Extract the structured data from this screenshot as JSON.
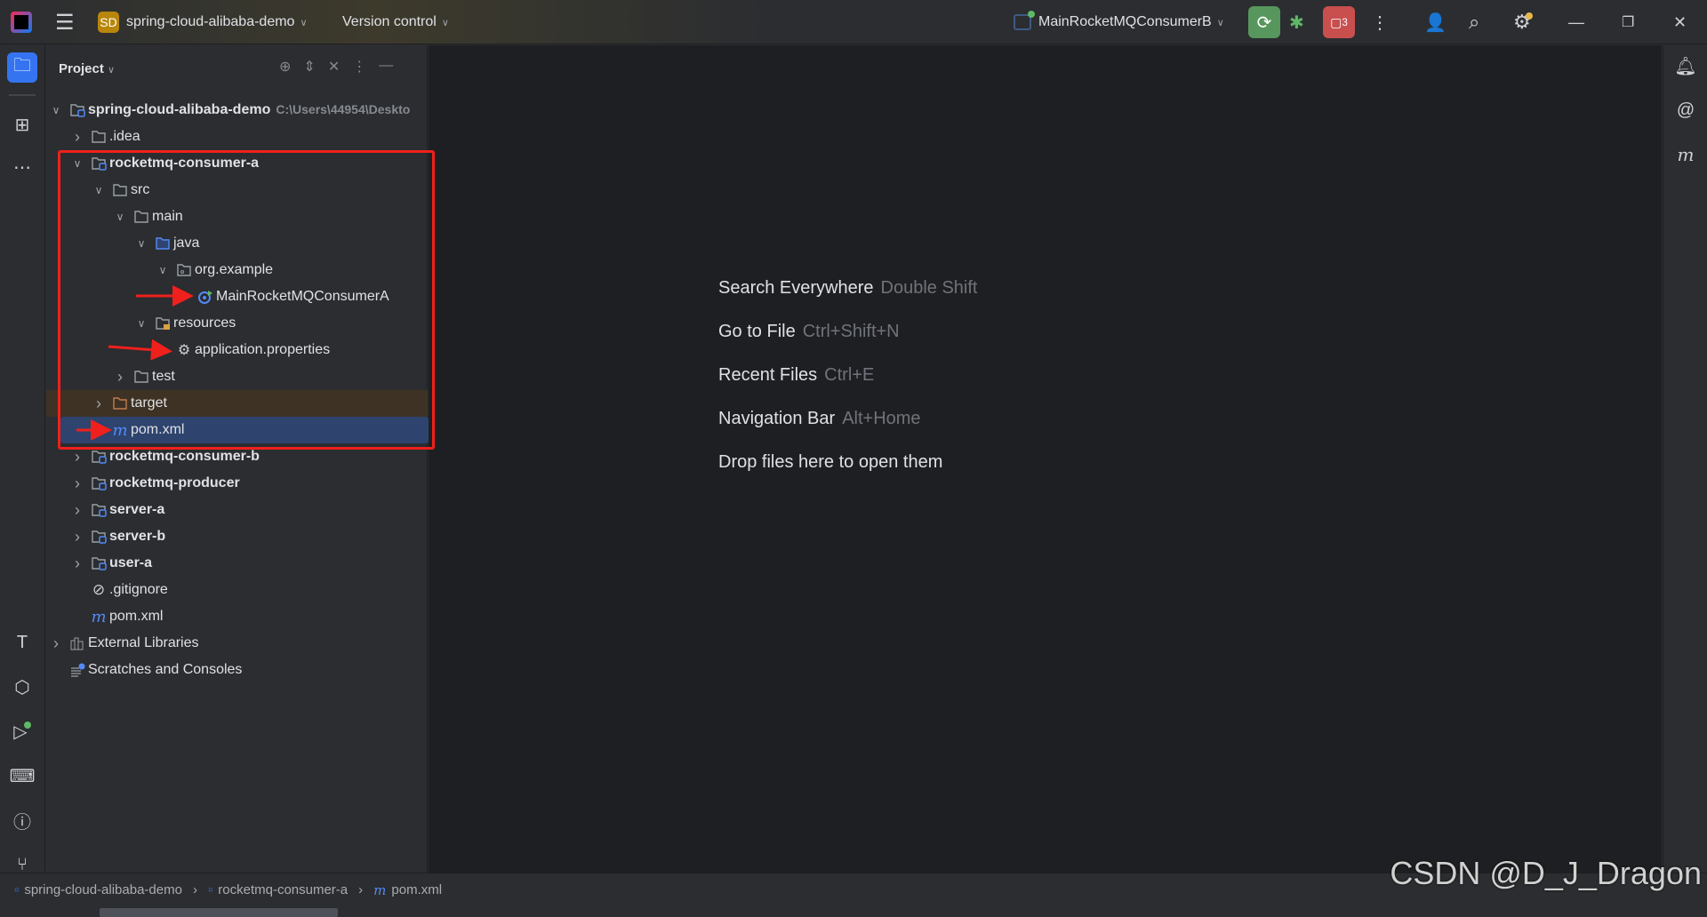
{
  "titlebar": {
    "project_badge": "SD",
    "project_name": "spring-cloud-alibaba-demo",
    "vcs_label": "Version control",
    "run_config": "MainRocketMQConsumerB",
    "stop_count": "3"
  },
  "left_strip": [
    "project-icon",
    "structure-icon",
    "more-icon",
    "build-icon",
    "services-icon",
    "run-icon",
    "terminal-icon",
    "problems-icon",
    "git-icon"
  ],
  "panel": {
    "title": "Project",
    "tree": [
      {
        "label": "spring-cloud-alibaba-demo",
        "level": 0,
        "chevron": "open",
        "icon": "module",
        "bold": true,
        "hint": "C:\\Users\\44954\\Deskto"
      },
      {
        "label": ".idea",
        "level": 1,
        "chevron": "closed",
        "icon": "folder"
      },
      {
        "label": "rocketmq-consumer-a",
        "level": 1,
        "chevron": "open",
        "icon": "module",
        "bold": true
      },
      {
        "label": "src",
        "level": 2,
        "chevron": "open",
        "icon": "folder"
      },
      {
        "label": "main",
        "level": 3,
        "chevron": "open",
        "icon": "folder"
      },
      {
        "label": "java",
        "level": 4,
        "chevron": "open",
        "icon": "source-folder"
      },
      {
        "label": "org.example",
        "level": 5,
        "chevron": "open",
        "icon": "package"
      },
      {
        "label": "MainRocketMQConsumerA",
        "level": 6,
        "chevron": "none",
        "icon": "spring-class"
      },
      {
        "label": "resources",
        "level": 4,
        "chevron": "open",
        "icon": "resources-folder"
      },
      {
        "label": "application.properties",
        "level": 5,
        "chevron": "none",
        "icon": "gear"
      },
      {
        "label": "test",
        "level": 3,
        "chevron": "closed",
        "icon": "folder"
      },
      {
        "label": "target",
        "level": 2,
        "chevron": "closed",
        "icon": "excluded-folder",
        "excluded": true
      },
      {
        "label": "pom.xml",
        "level": 2,
        "chevron": "none",
        "icon": "maven",
        "selected": true
      },
      {
        "label": "rocketmq-consumer-b",
        "level": 1,
        "chevron": "closed",
        "icon": "module",
        "bold": true
      },
      {
        "label": "rocketmq-producer",
        "level": 1,
        "chevron": "closed",
        "icon": "module",
        "bold": true
      },
      {
        "label": "server-a",
        "level": 1,
        "chevron": "closed",
        "icon": "module",
        "bold": true
      },
      {
        "label": "server-b",
        "level": 1,
        "chevron": "closed",
        "icon": "module",
        "bold": true
      },
      {
        "label": "user-a",
        "level": 1,
        "chevron": "closed",
        "icon": "module",
        "bold": true
      },
      {
        "label": ".gitignore",
        "level": 1,
        "chevron": "none",
        "icon": "ignore"
      },
      {
        "label": "pom.xml",
        "level": 1,
        "chevron": "none",
        "icon": "maven"
      },
      {
        "label": "External Libraries",
        "level": 0,
        "chevron": "closed",
        "icon": "library"
      },
      {
        "label": "Scratches and Consoles",
        "level": 0,
        "chevron": "none",
        "icon": "scratches"
      }
    ]
  },
  "welcome": [
    {
      "action": "Search Everywhere",
      "shortcut": "Double Shift"
    },
    {
      "action": "Go to File",
      "shortcut": "Ctrl+Shift+N"
    },
    {
      "action": "Recent Files",
      "shortcut": "Ctrl+E"
    },
    {
      "action": "Navigation Bar",
      "shortcut": "Alt+Home"
    },
    {
      "action": "Drop files here to open them",
      "shortcut": ""
    }
  ],
  "breadcrumbs": [
    "spring-cloud-alibaba-demo",
    "rocketmq-consumer-a",
    "pom.xml"
  ],
  "watermark": "CSDN @D_J_Dragon",
  "colors": {
    "accent": "#3574f0",
    "run": "#57965c",
    "stop": "#c94f4f",
    "annotation": "#f0201c"
  }
}
